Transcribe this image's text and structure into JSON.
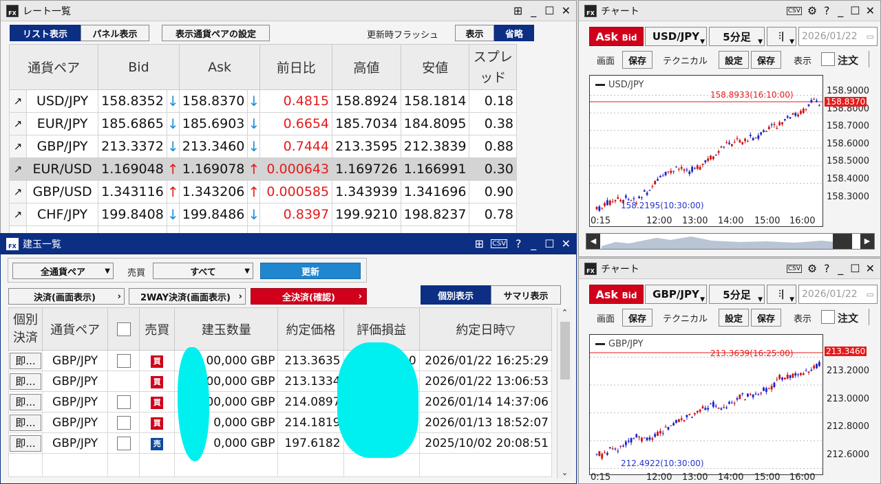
{
  "colors": {
    "up": "#e41b1b",
    "down": "#1a8fd8",
    "navy": "#0c2f84",
    "red": "#d0001a",
    "masked": "#00f0f0"
  },
  "rate_window": {
    "title": "レート一覧",
    "controls": [
      "⊞",
      "_",
      "☐",
      "✕"
    ],
    "tabs": {
      "list": "リスト表示",
      "panel": "パネル表示",
      "settings": "表示通貨ペアの設定"
    },
    "flash": {
      "label": "更新時フラッシュ",
      "show": "表示",
      "omit": "省略"
    },
    "headers": [
      "通貨ペア",
      "Bid",
      "Ask",
      "前日比",
      "高値",
      "安値",
      "スプレッド"
    ],
    "rows": [
      {
        "pair": "USD/JPY",
        "bid": "158.8352",
        "bid_dir": "↓",
        "ask": "158.8370",
        "ask_dir": "↓",
        "change": "0.4815",
        "high": "158.8924",
        "low": "158.1814",
        "spread": "0.18"
      },
      {
        "pair": "EUR/JPY",
        "bid": "185.6865",
        "bid_dir": "↓",
        "ask": "185.6903",
        "ask_dir": "↓",
        "change": "0.6654",
        "high": "185.7034",
        "low": "184.8095",
        "spread": "0.38"
      },
      {
        "pair": "GBP/JPY",
        "bid": "213.3372",
        "bid_dir": "↓",
        "ask": "213.3460",
        "ask_dir": "↓",
        "change": "0.7444",
        "high": "213.3595",
        "low": "212.3839",
        "spread": "0.88"
      },
      {
        "pair": "EUR/USD",
        "bid": "1.169048",
        "bid_dir": "↑",
        "ask": "1.169078",
        "ask_dir": "↑",
        "change": "0.000643",
        "high": "1.169726",
        "low": "1.166991",
        "spread": "0.30"
      },
      {
        "pair": "GBP/USD",
        "bid": "1.343116",
        "bid_dir": "↑",
        "ask": "1.343206",
        "ask_dir": "↑",
        "change": "0.000585",
        "high": "1.343939",
        "low": "1.341696",
        "spread": "0.90"
      },
      {
        "pair": "CHF/JPY",
        "bid": "199.8408",
        "bid_dir": "↓",
        "ask": "199.8486",
        "ask_dir": "↓",
        "change": "0.8397",
        "high": "199.9210",
        "low": "198.8237",
        "spread": "0.78"
      }
    ]
  },
  "position_window": {
    "title": "建玉一覧",
    "controls": [
      "⊞",
      "CSV",
      "?",
      "_",
      "☐",
      "✕"
    ],
    "filter_pair": "全通貨ペア",
    "side_label": "売買",
    "side_value": "すべて",
    "refresh": "更新",
    "settle_screen": "決済(画面表示)",
    "twoway": "2WAY決済(画面表示)",
    "settle_all": "全決済(確認)",
    "view_individual": "個別表示",
    "view_summary": "サマリ表示",
    "headers": [
      "個別決済",
      "通貨ペア",
      "",
      "売買",
      "建玉数量",
      "約定価格",
      "評価損益",
      "約定日時▽"
    ],
    "rows": [
      {
        "btn": "即...",
        "pair": "GBP/JPY",
        "checkbox": true,
        "side": "買",
        "qty": "00,000 GBP",
        "price": "213.3635",
        "pl": "0",
        "time": "2026/01/22 16:25:29"
      },
      {
        "btn": "即...",
        "pair": "GBP/JPY",
        "checkbox": false,
        "side": "買",
        "qty": "00,000 GBP",
        "price": "213.1334",
        "pl": "",
        "time": "2026/01/22 13:06:53"
      },
      {
        "btn": "即...",
        "pair": "GBP/JPY",
        "checkbox": true,
        "side": "買",
        "qty": "00,000 GBP",
        "price": "214.0897",
        "pl": "",
        "time": "2026/01/14 14:37:06"
      },
      {
        "btn": "即...",
        "pair": "GBP/JPY",
        "checkbox": true,
        "side": "買",
        "qty": "0,000 GBP",
        "price": "214.1819",
        "pl": "",
        "time": "2026/01/13 18:52:07"
      },
      {
        "btn": "即...",
        "pair": "GBP/JPY",
        "checkbox": true,
        "side": "売",
        "qty": "0,000 GBP",
        "price": "197.6182",
        "pl": "",
        "time": "2025/10/02 20:08:51"
      }
    ]
  },
  "charts": [
    {
      "title": "チャート",
      "ask_label": "Ask",
      "bid_label": "Bid",
      "pair": "USD/JPY",
      "timeframe": "5分足",
      "date": "2026/01/22",
      "toolbar": {
        "screen": "画面",
        "save": "保存",
        "technical": "テクニカル",
        "setting": "設定",
        "save2": "保存",
        "display": "表示",
        "order": "注文"
      },
      "legend": "USD/JPY",
      "high_label": "158.8933(16:10:00)",
      "low_label": "158.2195(10:30:00)",
      "price_tag": "158.8370",
      "yticks": [
        "158.9000",
        "158.8000",
        "158.7000",
        "158.6000",
        "158.5000",
        "158.4000",
        "158.3000"
      ],
      "xticks": [
        "0:15",
        "12:00",
        "13:00",
        "14:00",
        "15:00",
        "16:00"
      ]
    },
    {
      "title": "チャート",
      "ask_label": "Ask",
      "bid_label": "Bid",
      "pair": "GBP/JPY",
      "timeframe": "5分足",
      "date": "2026/01/22",
      "toolbar": {
        "screen": "画面",
        "save": "保存",
        "technical": "テクニカル",
        "setting": "設定",
        "save2": "保存",
        "display": "表示",
        "order": "注文"
      },
      "legend": "GBP/JPY",
      "high_label": "213.3639(16:25:00)",
      "low_label": "212.4922(10:30:00)",
      "price_tag": "213.3460",
      "yticks": [
        "213.2000",
        "213.0000",
        "212.8000",
        "212.6000"
      ],
      "xticks": [
        "0:15",
        "12:00",
        "13:00",
        "14:00",
        "15:00",
        "16:00"
      ]
    }
  ]
}
